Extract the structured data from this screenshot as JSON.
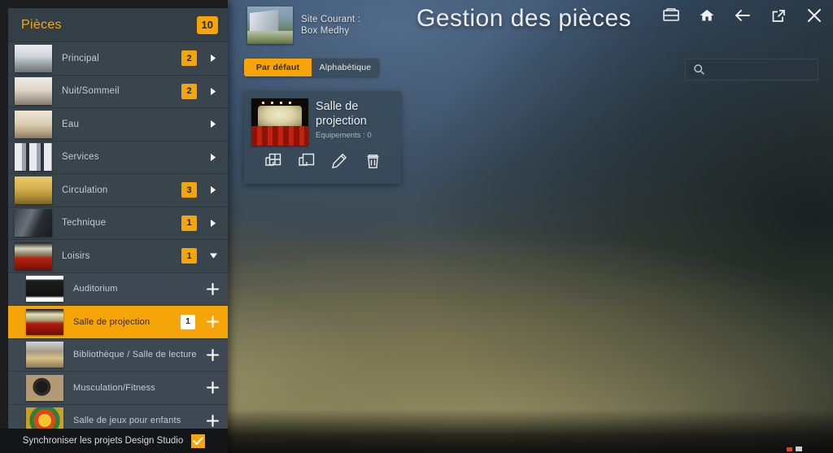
{
  "header": {
    "site_label": "Site Courant :",
    "site_name": "Box Medhy",
    "page_title": "Gestion des pièces",
    "icons": [
      {
        "name": "inbox-icon",
        "label": "Inbox"
      },
      {
        "name": "home-icon",
        "label": "Accueil"
      },
      {
        "name": "back-arrow-icon",
        "label": "Retour"
      },
      {
        "name": "external-link-icon",
        "label": "Ouvrir"
      },
      {
        "name": "close-icon",
        "label": "Fermer"
      }
    ]
  },
  "toolbar": {
    "tabs": [
      {
        "label": "Par défaut",
        "active": true
      },
      {
        "label": "Alphabétique",
        "active": false
      }
    ],
    "search": {
      "value": "",
      "placeholder": "",
      "icon": "search-icon"
    }
  },
  "main": {
    "cards": [
      {
        "title": "Salle de projection",
        "subtitle": "Equipements : 0",
        "thumb": "cinema-seats",
        "actions": [
          {
            "name": "duplicate-grid-icon",
            "label": "Dupliquer en grille"
          },
          {
            "name": "copy-icon",
            "label": "Copier"
          },
          {
            "name": "edit-pencil-icon",
            "label": "Modifier"
          },
          {
            "name": "delete-trash-icon",
            "label": "Supprimer"
          }
        ]
      }
    ]
  },
  "sidebar": {
    "title": "Pièces",
    "count": "10",
    "categories": [
      {
        "label": "Principal",
        "count": "2",
        "expanded": false,
        "thumb": "th-principal"
      },
      {
        "label": "Nuit/Sommeil",
        "count": "2",
        "expanded": false,
        "thumb": "th-nuit"
      },
      {
        "label": "Eau",
        "count": "",
        "expanded": false,
        "thumb": "th-eau"
      },
      {
        "label": "Services",
        "count": "",
        "expanded": false,
        "thumb": "th-services"
      },
      {
        "label": "Circulation",
        "count": "3",
        "expanded": false,
        "thumb": "th-circ"
      },
      {
        "label": "Technique",
        "count": "1",
        "expanded": false,
        "thumb": "th-tech"
      },
      {
        "label": "Loisirs",
        "count": "1",
        "expanded": true,
        "thumb": "th-loisirs"
      }
    ],
    "subitems": [
      {
        "label": "Auditorium",
        "count": "",
        "selected": false,
        "thumb": "th-audit"
      },
      {
        "label": "Salle de projection",
        "count": "1",
        "selected": true,
        "thumb": "th-salle"
      },
      {
        "label": "Bibliothèque / Salle de lecture",
        "count": "",
        "selected": false,
        "thumb": "th-biblio"
      },
      {
        "label": "Musculation/Fitness",
        "count": "",
        "selected": false,
        "thumb": "th-muscu"
      },
      {
        "label": "Salle de jeux pour enfants",
        "count": "",
        "selected": false,
        "thumb": "th-jeux"
      }
    ],
    "sync": {
      "label": "Synchroniser les projets Design Studio",
      "checked": true
    }
  },
  "colors": {
    "accent": "#f5a507",
    "panel": "#39444c",
    "panel_header": "#333e45",
    "sub_row": "#3d4852",
    "text_light": "#c3ccd4"
  }
}
